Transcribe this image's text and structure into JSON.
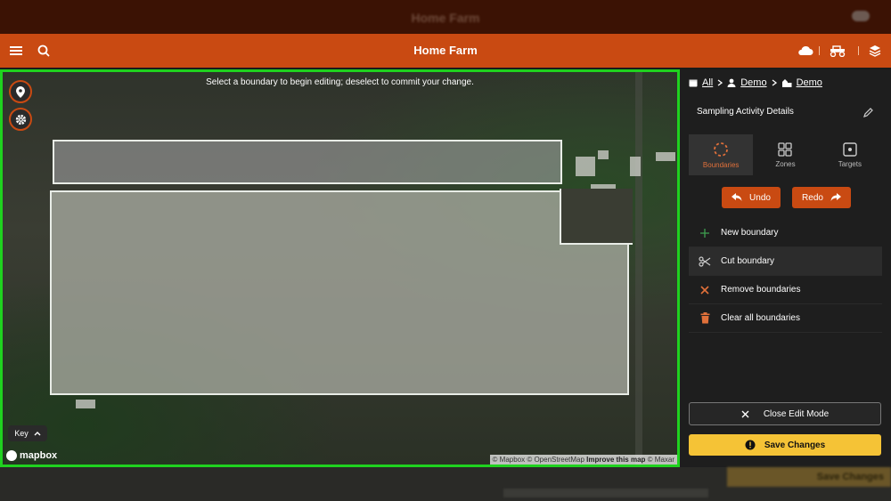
{
  "background": {
    "title": "Home Farm",
    "save_label": "Save Changes"
  },
  "header": {
    "title": "Home Farm",
    "icons": [
      "menu-icon",
      "search-icon",
      "cloud-icon",
      "tractor-icon",
      "layers-icon"
    ]
  },
  "map": {
    "banner": "Select a boundary to begin editing; deselect to commit your change.",
    "key_label": "Key",
    "mapbox_label": "mapbox",
    "attribution": {
      "mapbox": "© Mapbox",
      "osm": "© OpenStreetMap",
      "improve": "Improve this map",
      "maxar": "© Maxar"
    }
  },
  "panel": {
    "breadcrumb": {
      "all": "All",
      "client": "Demo",
      "farm": "Demo"
    },
    "section_title": "Sampling Activity Details",
    "tabs": [
      {
        "label": "Boundaries",
        "active": true
      },
      {
        "label": "Zones",
        "active": false
      },
      {
        "label": "Targets",
        "active": false
      }
    ],
    "undo_label": "Undo",
    "redo_label": "Redo",
    "actions": [
      {
        "label": "New boundary",
        "icon": "plus-icon"
      },
      {
        "label": "Cut boundary",
        "icon": "scissors-icon"
      },
      {
        "label": "Remove boundaries",
        "icon": "x-icon"
      },
      {
        "label": "Clear all boundaries",
        "icon": "trash-icon"
      }
    ],
    "close_edit_label": "Close Edit Mode",
    "save_label": "Save Changes"
  },
  "colors": {
    "accent": "#c94a12",
    "map_border": "#1fd21f",
    "save": "#f5c336"
  }
}
